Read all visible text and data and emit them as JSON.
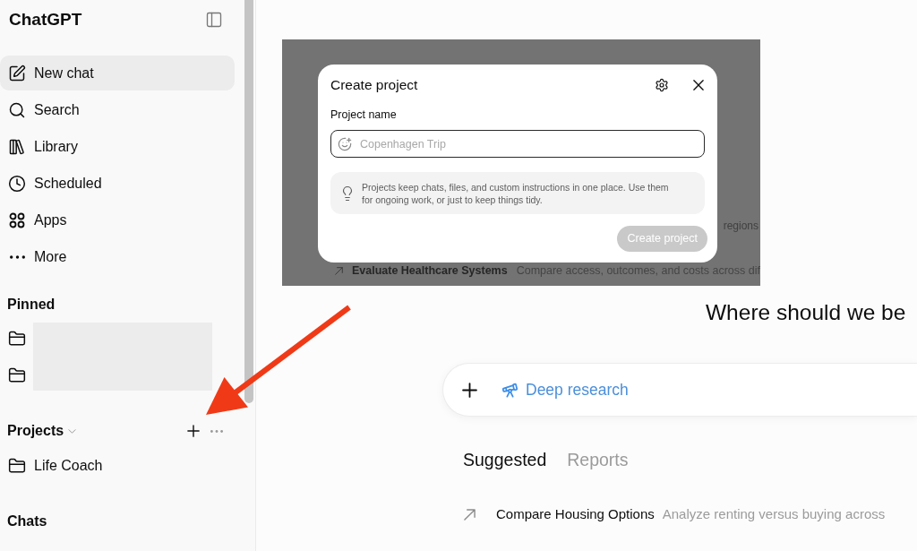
{
  "sidebar": {
    "title": "ChatGPT",
    "nav": [
      {
        "label": "New chat",
        "selected": true
      },
      {
        "label": "Search",
        "selected": false
      },
      {
        "label": "Library",
        "selected": false
      },
      {
        "label": "Scheduled",
        "selected": false
      },
      {
        "label": "Apps",
        "selected": false
      },
      {
        "label": "More",
        "selected": false
      }
    ],
    "pinned": {
      "title": "Pinned"
    },
    "projects": {
      "title": "Projects",
      "items": [
        {
          "label": "Life Coach"
        }
      ]
    },
    "chats": {
      "title": "Chats"
    }
  },
  "inset": {
    "background": {
      "fragment": "regions",
      "suggestion": {
        "title": "Evaluate Healthcare Systems",
        "description": "Compare access, outcomes, and costs across dif"
      }
    },
    "dialog": {
      "title": "Create project",
      "field_label": "Project name",
      "name_field": {
        "placeholder": "Copenhagen Trip"
      },
      "tip": "Projects keep chats, files, and custom instructions in one place. Use them for ongoing work, or just to keep things tidy.",
      "submit": {
        "label": "Create project",
        "disabled": true
      }
    }
  },
  "main": {
    "heading": "Where should we be",
    "composer": {
      "tool": "Deep research"
    },
    "tabs": [
      {
        "label": "Suggested",
        "selected": true
      },
      {
        "label": "Reports",
        "selected": false
      }
    ],
    "suggestions": [
      {
        "title": "Compare Housing Options",
        "description": "Analyze renting versus buying across"
      }
    ]
  }
}
